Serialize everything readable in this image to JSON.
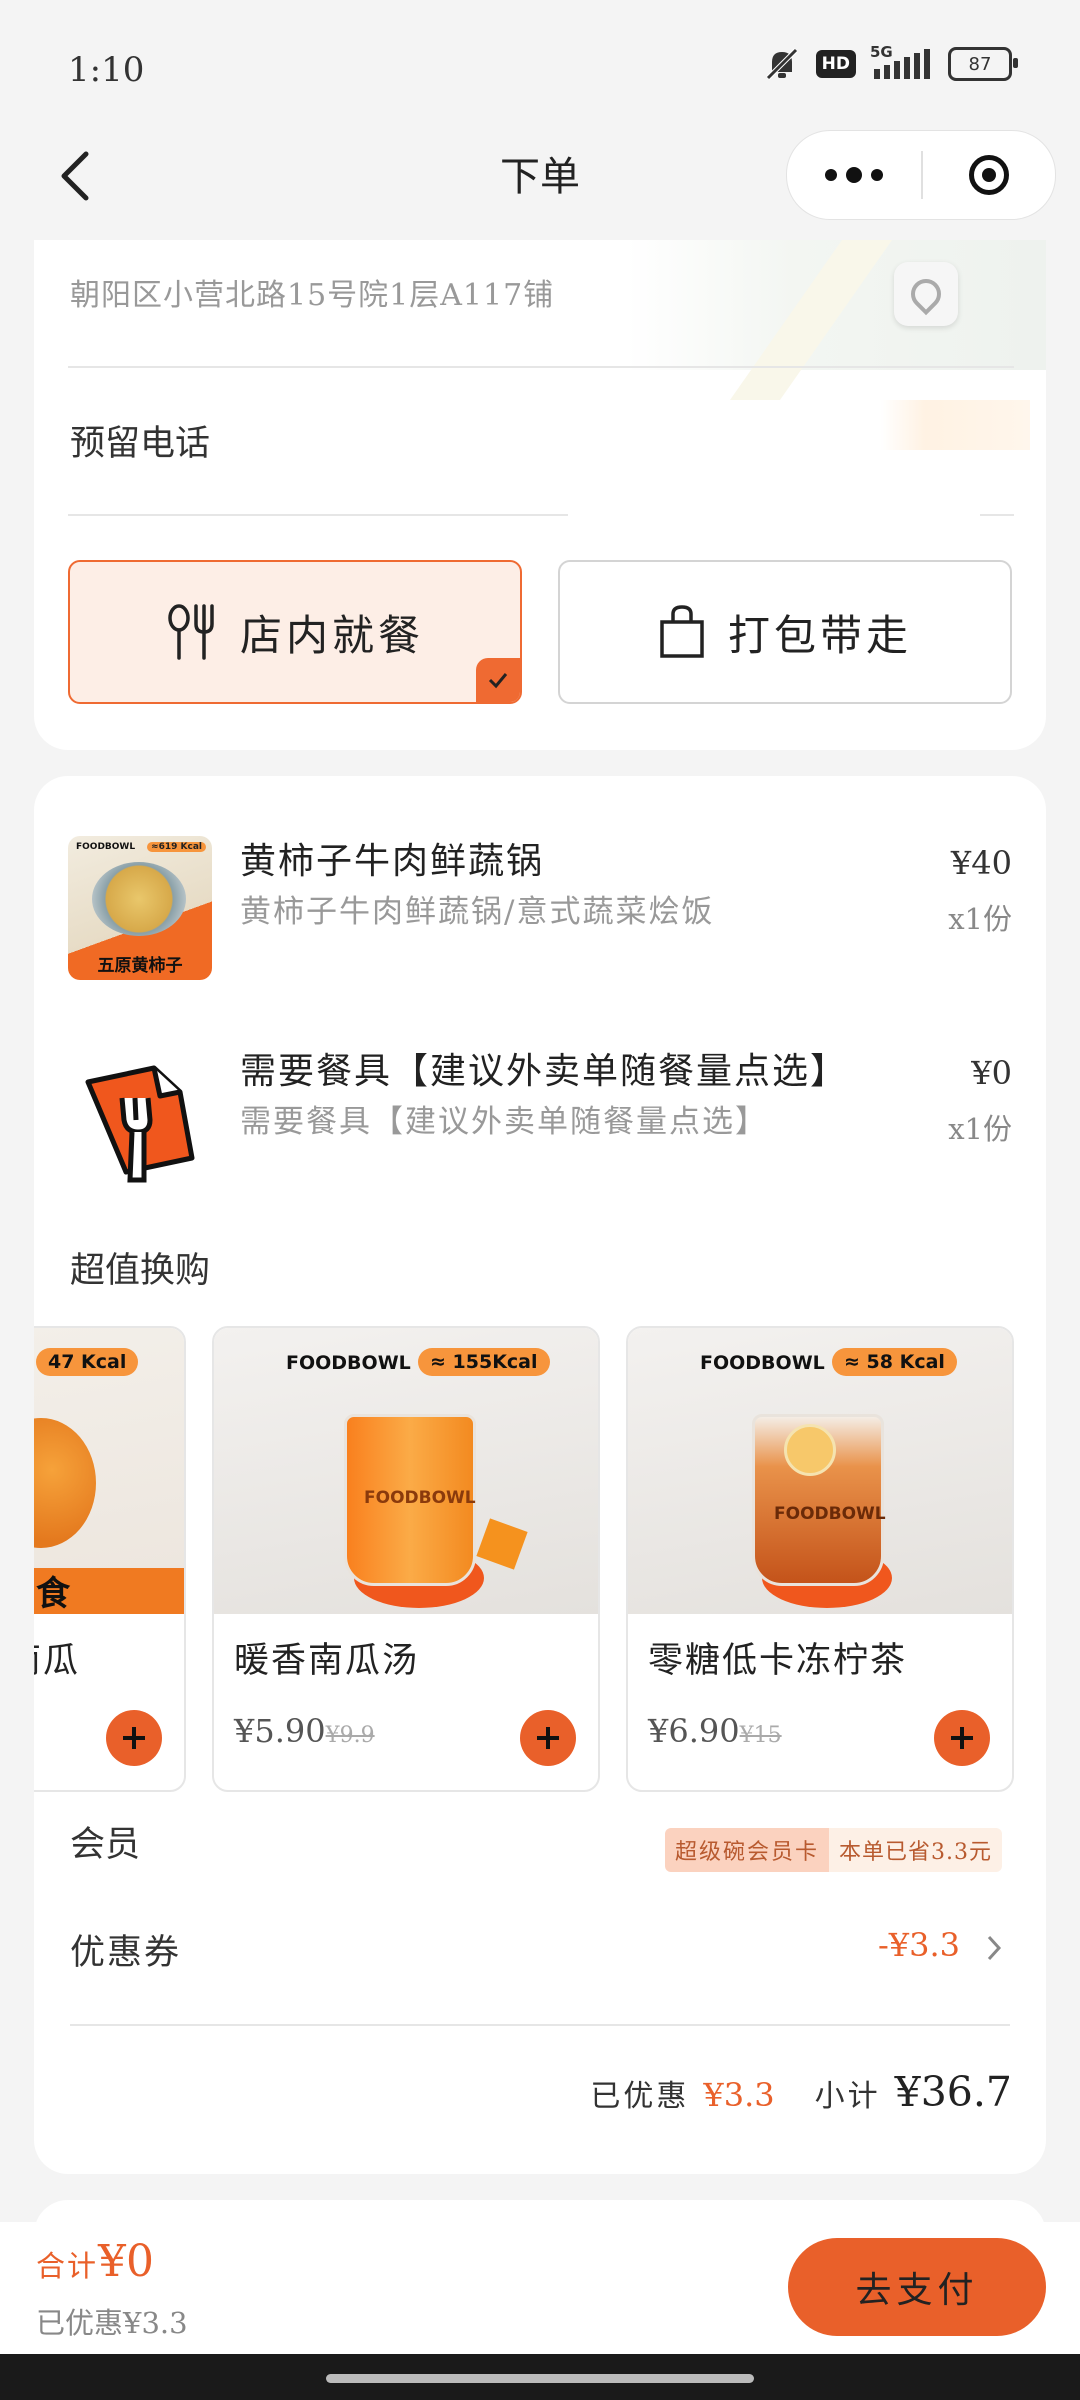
{
  "status_bar": {
    "time": "1:10",
    "hd": "HD",
    "network": "5G",
    "battery": "87"
  },
  "nav": {
    "title": "下单"
  },
  "store": {
    "address": "朝阳区小营北路15号院1层A117铺"
  },
  "phone": {
    "label": "预留电话"
  },
  "dining_options": [
    {
      "label": "店内就餐",
      "selected": true,
      "icon": "utensils-icon"
    },
    {
      "label": "打包带走",
      "selected": false,
      "icon": "bag-icon"
    }
  ],
  "order_items": [
    {
      "name": "黄柿子牛肉鲜蔬锅",
      "desc": "黄柿子牛肉鲜蔬锅/意式蔬菜烩饭",
      "price": "¥40",
      "qty": "x1份",
      "img_brand": "FOODBOWL",
      "img_kcal": "≈619 Kcal",
      "img_caption": "五原黄柿子"
    },
    {
      "name": "需要餐具【建议外卖单随餐量点选】",
      "desc": "需要餐具【建议外卖单随餐量点选】",
      "price": "¥0",
      "qty": "x1份"
    }
  ],
  "upsell": {
    "title": "超值换购",
    "items": [
      {
        "name": "南瓜",
        "kcal": "47 Kcal",
        "tag": "食"
      },
      {
        "name": "暖香南瓜汤",
        "brand": "FOODBOWL",
        "kcal": "≈ 155Kcal",
        "cup_brand": "FOODBOWL",
        "price": "¥5.90",
        "orig_price": "¥9.9"
      },
      {
        "name": "零糖低卡冻柠茶",
        "brand": "FOODBOWL",
        "kcal": "≈ 58 Kcal",
        "cup_brand": "FOODBOWL",
        "price": "¥6.90",
        "orig_price": "¥15"
      }
    ]
  },
  "member": {
    "label": "会员",
    "card_tag": "超级碗会员卡",
    "saved_tag": "本单已省3.3元"
  },
  "coupon": {
    "label": "优惠券",
    "value": "-¥3.3"
  },
  "summary": {
    "discount_label": "已优惠",
    "discount": "¥3.3",
    "subtotal_label": "小计",
    "subtotal": "¥36.7"
  },
  "bottom": {
    "total_label": "合计",
    "total": "¥0",
    "saved": "已优惠¥3.3",
    "pay_label": "去支付"
  },
  "colors": {
    "accent": "#e9602a",
    "selected_bg": "#fdeee6"
  }
}
